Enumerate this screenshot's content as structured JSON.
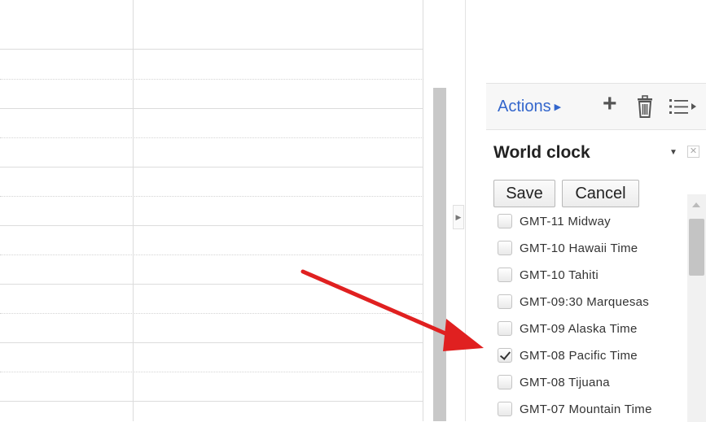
{
  "panel": {
    "actions_label": "Actions",
    "icons": [
      "add-icon",
      "trash-icon",
      "list-icon"
    ],
    "widget_title": "World clock",
    "save_label": "Save",
    "cancel_label": "Cancel"
  },
  "timezones": [
    {
      "label": "GMT-11 Midway",
      "checked": false
    },
    {
      "label": "GMT-10 Hawaii Time",
      "checked": false
    },
    {
      "label": "GMT-10 Tahiti",
      "checked": false
    },
    {
      "label": "GMT-09:30 Marquesas",
      "checked": false
    },
    {
      "label": "GMT-09 Alaska Time",
      "checked": false
    },
    {
      "label": "GMT-08 Pacific Time",
      "checked": true
    },
    {
      "label": "GMT-08 Tijuana",
      "checked": false
    },
    {
      "label": "GMT-07 Mountain Time",
      "checked": false
    }
  ],
  "colors": {
    "link": "#3366cc",
    "arrow": "#e02020"
  }
}
